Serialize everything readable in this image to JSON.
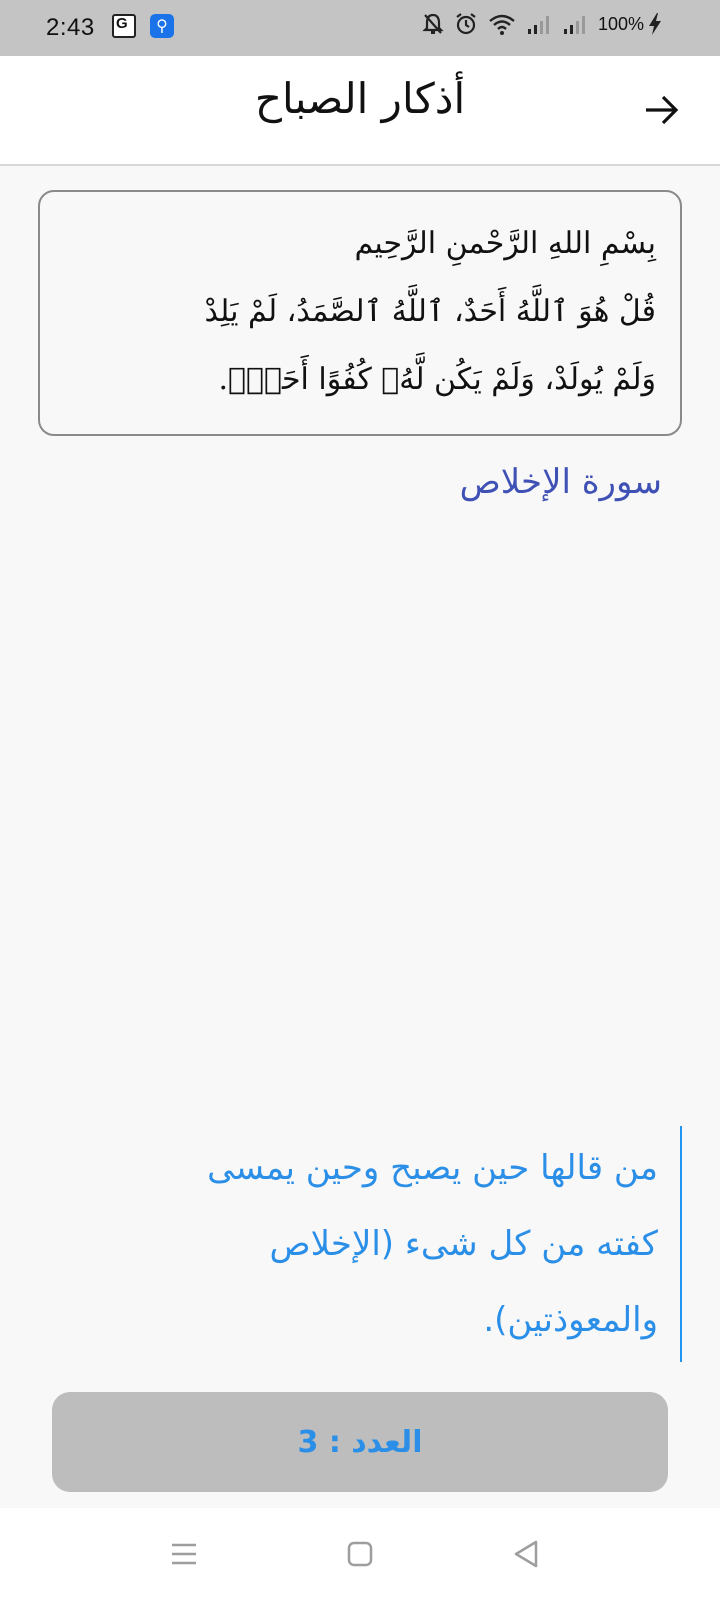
{
  "status_bar": {
    "time": "2:43",
    "battery": "100%",
    "icons": [
      "translate-icon",
      "usb-icon",
      "mute-icon",
      "alarm-icon",
      "wifi-icon",
      "signal-icon",
      "signal-icon",
      "charging-icon"
    ]
  },
  "header": {
    "title": "أذكار الصباح",
    "back_icon": "arrow-right-icon"
  },
  "dhikr": {
    "lines": [
      "بِسْمِ اللهِ الرَّحْمنِ الرَّحِيم",
      "قُلْ هُوَ ٱللَّهُ أَحَدٌ، ٱللَّهُ ٱلصَّمَدُ، لَمْ يَلِدْ",
      "وَلَمْ يُولَدْ، وَلَمْ يَكُن لَّهُۥ كُفُوًا أَحَدٌۢ."
    ],
    "source": "سورة الإخلاص"
  },
  "virtue": {
    "lines": [
      "من قالها حين يصبح وحين يمسى",
      "كفته من كل شىء (الإخلاص",
      "والمعوذتين)."
    ]
  },
  "counter": {
    "label": "العدد : 3",
    "count": 3
  },
  "nav_bar": {
    "icons": [
      "menu-icon",
      "home-icon",
      "back-icon"
    ]
  },
  "colors": {
    "status_bar": "#c4c4c4",
    "source_text": "#3f51b5",
    "accent_blue": "#2b8fe8",
    "counter_bg": "#bdbdbd"
  }
}
